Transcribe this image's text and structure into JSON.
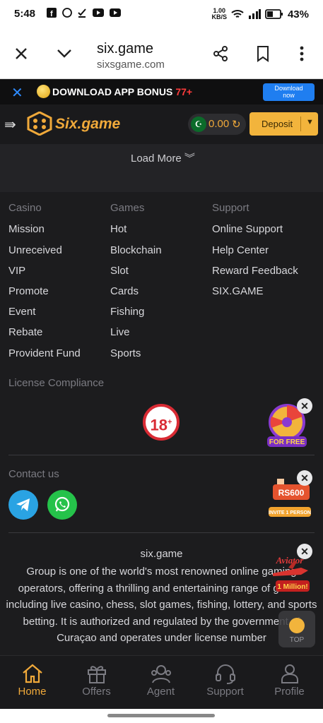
{
  "statusbar": {
    "time": "5:48",
    "net_speed_top": "1.00",
    "net_speed_bottom": "KB/S",
    "battery": "43%"
  },
  "browser": {
    "domain": "six.game",
    "subdomain": "sixsgame.com"
  },
  "promo": {
    "text": "DOWNLOAD APP BONUS",
    "bonus": "77+",
    "button_line1": "Download",
    "button_line2": "now"
  },
  "header": {
    "brand": "Six.game",
    "balance": "0.00",
    "deposit_label": "Deposit"
  },
  "load_more": "Load More",
  "footer": {
    "columns": [
      {
        "title": "Casino",
        "items": [
          "Mission",
          "Unreceived",
          "VIP",
          "Promote",
          "Event",
          "Rebate",
          "Provident Fund"
        ]
      },
      {
        "title": "Games",
        "items": [
          "Hot",
          "Blockchain",
          "Slot",
          "Cards",
          "Fishing",
          "Live",
          "Sports"
        ]
      },
      {
        "title": "Support",
        "items": [
          "Online Support",
          "Help Center",
          "Reward Feedback",
          "SIX.GAME"
        ]
      }
    ],
    "license_title": "License Compliance",
    "age_badge": "18",
    "age_plus": "+",
    "contact_title": "Contact us",
    "about_title": "six.game",
    "about_body": "Group is one of the world's most renowned online gaming operators, offering a thrilling and entertaining range of games including live casino, chess, slot games, fishing, lottery, and sports betting. It is authorized and regulated by the government of Curaçao and operates under license number"
  },
  "floating": {
    "wheel_label": "FOR FREE",
    "invite_amount": "RS600",
    "invite_label": "INVITE 1 PERSON",
    "aviator_label": "Aviator",
    "aviator_sub": "1 Million!",
    "top_label": "TOP"
  },
  "bottom_nav": [
    {
      "label": "Home",
      "active": true
    },
    {
      "label": "Offers",
      "active": false
    },
    {
      "label": "Agent",
      "active": false
    },
    {
      "label": "Support",
      "active": false
    },
    {
      "label": "Profile",
      "active": false
    }
  ],
  "colors": {
    "accent": "#f0a93a",
    "background": "#1c1c1e",
    "promo_button": "#1f7ef0",
    "bonus_red": "#ff3b3b"
  }
}
